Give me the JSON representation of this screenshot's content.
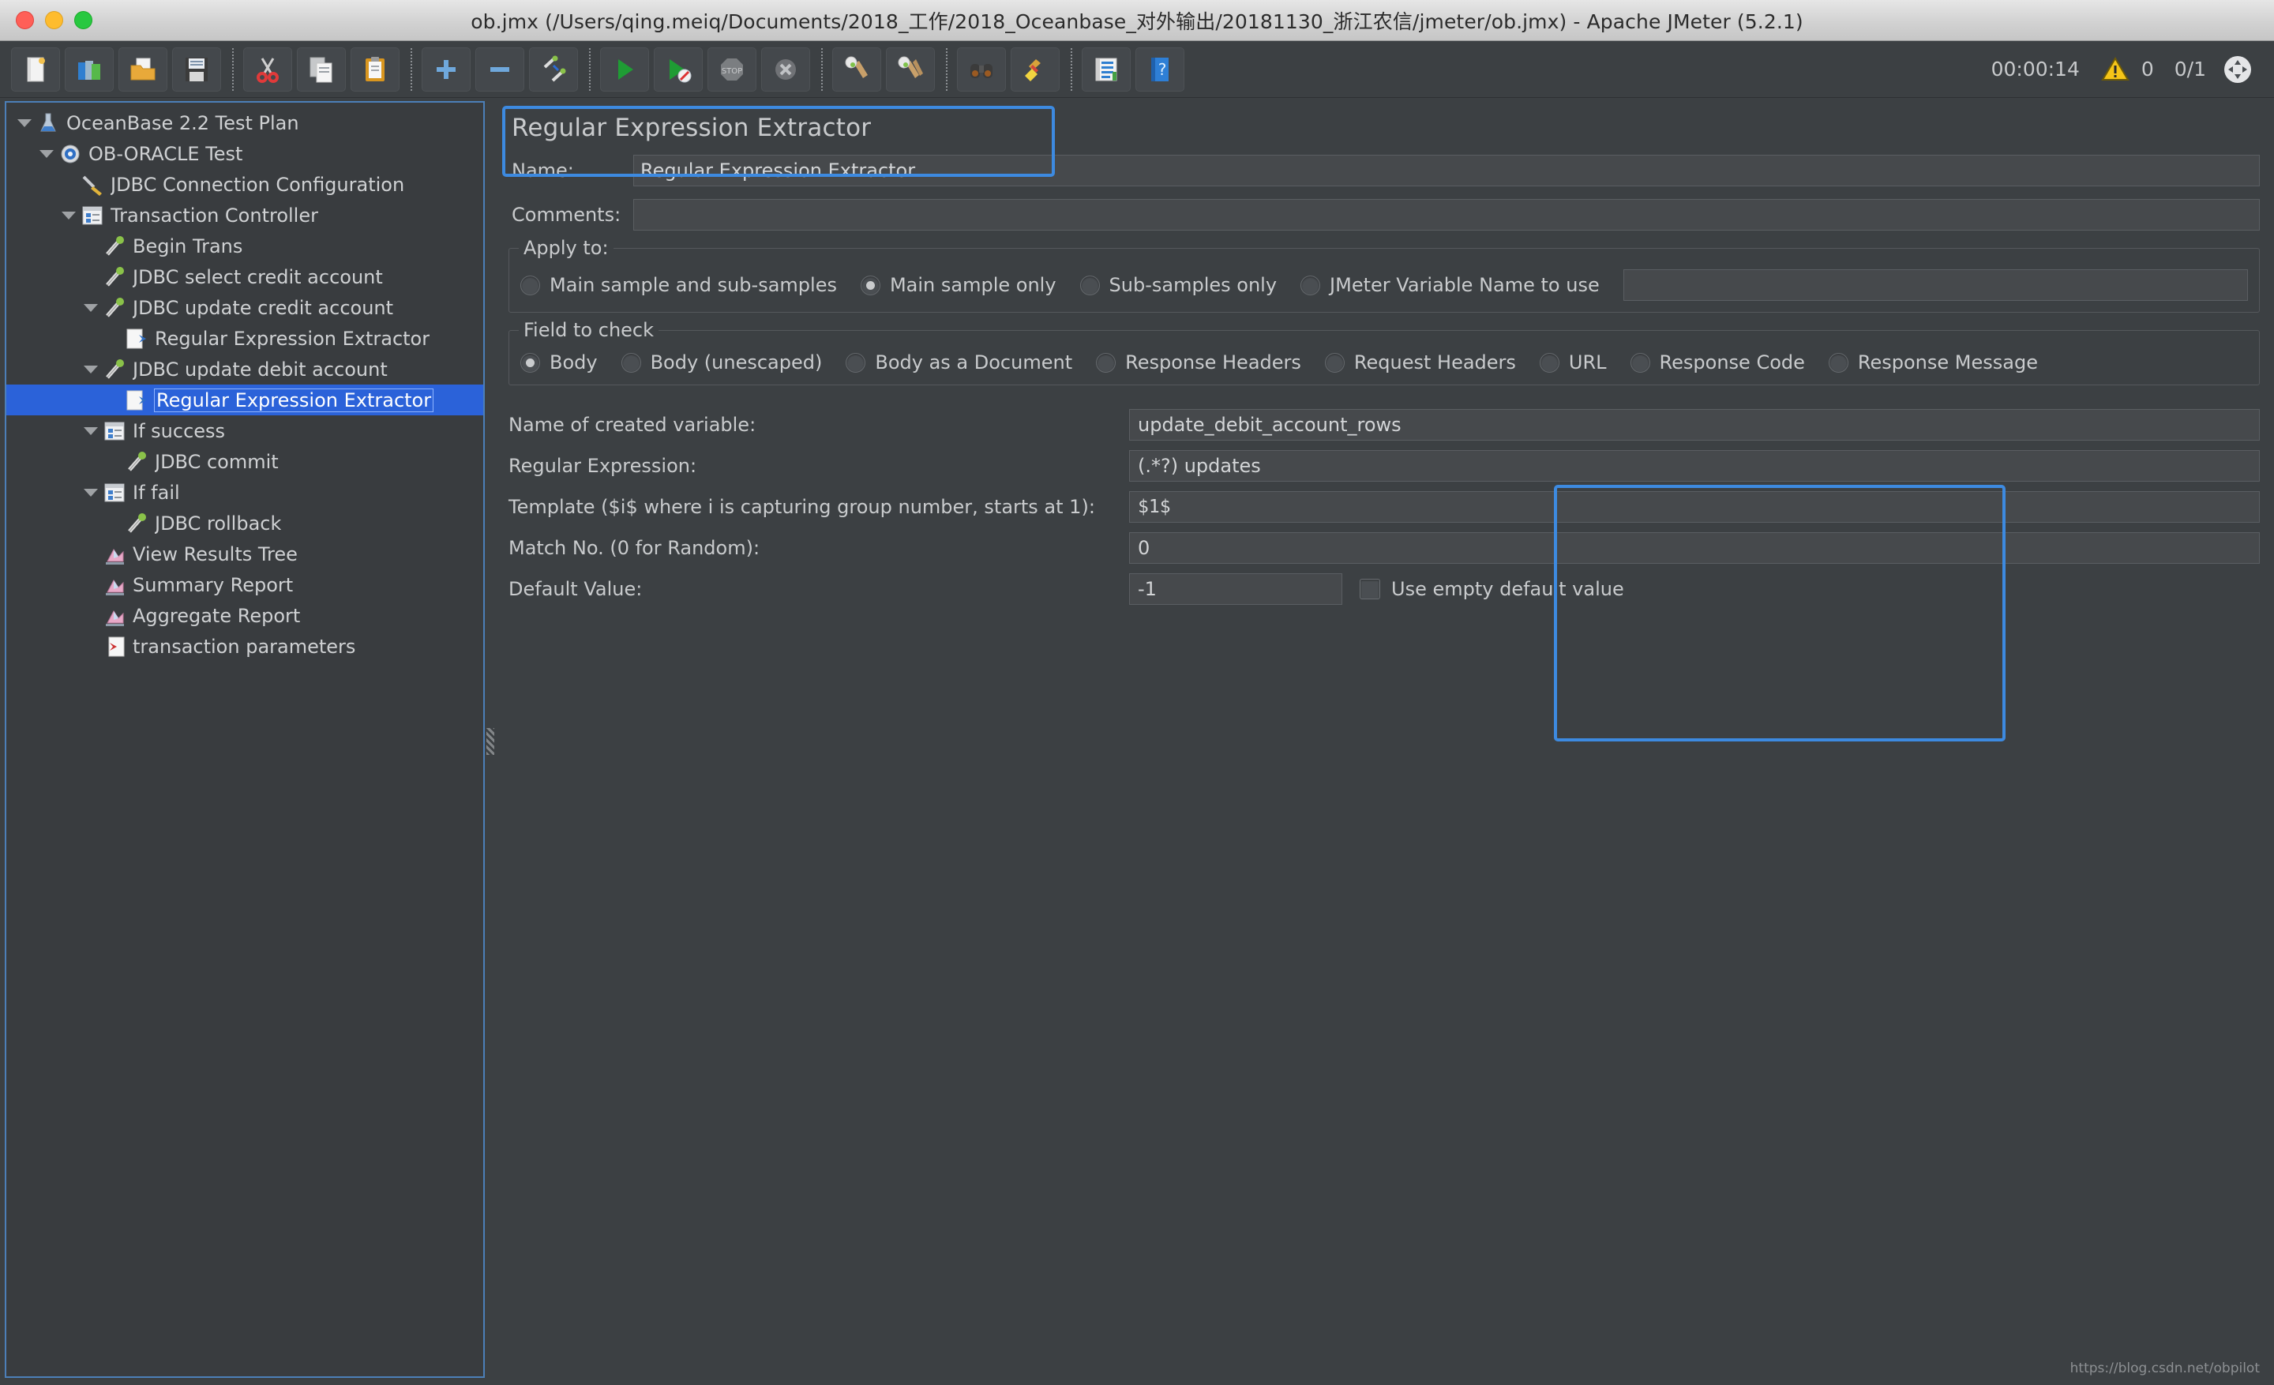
{
  "window": {
    "title": "ob.jmx (/Users/qing.meiq/Documents/2018_工作/2018_Oceanbase_对外输出/20181130_浙江农信/jmeter/ob.jmx) - Apache JMeter (5.2.1)",
    "close_label": "close",
    "minimize_label": "minimize",
    "maximize_label": "maximize"
  },
  "toolbar": {
    "buttons": [
      {
        "name": "new-test-plan",
        "icon": "new-document-icon"
      },
      {
        "name": "templates",
        "icon": "templates-icon"
      },
      {
        "name": "open",
        "icon": "open-folder-icon"
      },
      {
        "name": "save-test-plan",
        "icon": "save-floppy-icon"
      },
      {
        "name": "cut",
        "icon": "scissors-icon"
      },
      {
        "name": "copy",
        "icon": "copy-pages-icon"
      },
      {
        "name": "paste",
        "icon": "clipboard-icon"
      },
      {
        "name": "expand-all",
        "icon": "plus-icon"
      },
      {
        "name": "collapse-all",
        "icon": "minus-icon"
      },
      {
        "name": "toggle",
        "icon": "toggle-sampler-icon"
      },
      {
        "name": "start",
        "icon": "start-green-play-icon"
      },
      {
        "name": "start-no-timers",
        "icon": "start-no-pauses-icon"
      },
      {
        "name": "stop",
        "icon": "stop-sign-icon"
      },
      {
        "name": "shutdown",
        "icon": "shutdown-x-icon"
      },
      {
        "name": "clear",
        "icon": "clear-broom-icon"
      },
      {
        "name": "clear-all",
        "icon": "clear-all-brooms-icon"
      },
      {
        "name": "search",
        "icon": "binoculars-search-icon"
      },
      {
        "name": "reset-search",
        "icon": "yellow-broom-icon"
      },
      {
        "name": "function-helper",
        "icon": "function-helper-icon"
      },
      {
        "name": "help",
        "icon": "help-book-icon"
      }
    ],
    "timer": "00:00:14",
    "warning_count": "0",
    "thread_count": "0/1",
    "warn_icon": "warning-triangle-icon",
    "remote_icon": "thread-status-icon"
  },
  "tree": {
    "items": [
      {
        "label": "OceanBase 2.2 Test Plan",
        "indent": 0,
        "twisty": "open",
        "icon": "test-plan-flask-icon",
        "selected": false
      },
      {
        "label": "OB-ORACLE Test",
        "indent": 1,
        "twisty": "open",
        "icon": "thread-group-gear-icon",
        "selected": false
      },
      {
        "label": "JDBC Connection Configuration",
        "indent": 2,
        "twisty": "none",
        "icon": "config-wrench-icon",
        "selected": false
      },
      {
        "label": "Transaction Controller",
        "indent": 2,
        "twisty": "open",
        "icon": "controller-icon",
        "selected": false
      },
      {
        "label": "Begin Trans",
        "indent": 3,
        "twisty": "none",
        "icon": "sampler-pipette-icon",
        "selected": false
      },
      {
        "label": "JDBC select credit account",
        "indent": 3,
        "twisty": "none",
        "icon": "sampler-pipette-icon",
        "selected": false
      },
      {
        "label": "JDBC update credit account",
        "indent": 3,
        "twisty": "open",
        "icon": "sampler-pipette-icon",
        "selected": false
      },
      {
        "label": "Regular Expression Extractor",
        "indent": 4,
        "twisty": "none",
        "icon": "post-processor-icon",
        "selected": false
      },
      {
        "label": "JDBC update debit account",
        "indent": 3,
        "twisty": "open",
        "icon": "sampler-pipette-icon",
        "selected": false
      },
      {
        "label": "Regular Expression Extractor",
        "indent": 4,
        "twisty": "none",
        "icon": "post-processor-icon",
        "selected": true
      },
      {
        "label": "If success",
        "indent": 3,
        "twisty": "open",
        "icon": "controller-icon",
        "selected": false
      },
      {
        "label": "JDBC commit",
        "indent": 4,
        "twisty": "none",
        "icon": "sampler-pipette-icon",
        "selected": false
      },
      {
        "label": "If fail",
        "indent": 3,
        "twisty": "open",
        "icon": "controller-icon",
        "selected": false
      },
      {
        "label": "JDBC rollback",
        "indent": 4,
        "twisty": "none",
        "icon": "sampler-pipette-icon",
        "selected": false
      },
      {
        "label": "View Results Tree",
        "indent": 3,
        "twisty": "none",
        "icon": "listener-chart-icon",
        "selected": false
      },
      {
        "label": "Summary Report",
        "indent": 3,
        "twisty": "none",
        "icon": "listener-chart-icon",
        "selected": false
      },
      {
        "label": "Aggregate Report",
        "indent": 3,
        "twisty": "none",
        "icon": "listener-chart-icon",
        "selected": false
      },
      {
        "label": "transaction parameters",
        "indent": 3,
        "twisty": "none",
        "icon": "csv-dataset-icon",
        "selected": false
      }
    ]
  },
  "editor": {
    "panel_title": "Regular Expression Extractor",
    "name_label": "Name:",
    "name_value": "Regular Expression Extractor",
    "comments_label": "Comments:",
    "comments_value": "",
    "apply_to": {
      "legend": "Apply to:",
      "options": [
        {
          "label": "Main sample and sub-samples",
          "checked": false
        },
        {
          "label": "Main sample only",
          "checked": true
        },
        {
          "label": "Sub-samples only",
          "checked": false
        },
        {
          "label": "JMeter Variable Name to use",
          "checked": false
        }
      ],
      "variable_value": ""
    },
    "field_to_check": {
      "legend": "Field to check",
      "options": [
        {
          "label": "Body",
          "checked": true
        },
        {
          "label": "Body (unescaped)",
          "checked": false
        },
        {
          "label": "Body as a Document",
          "checked": false
        },
        {
          "label": "Response Headers",
          "checked": false
        },
        {
          "label": "Request Headers",
          "checked": false
        },
        {
          "label": "URL",
          "checked": false
        },
        {
          "label": "Response Code",
          "checked": false
        },
        {
          "label": "Response Message",
          "checked": false
        }
      ]
    },
    "fields": {
      "variable_name_label": "Name of created variable:",
      "variable_name_value": "update_debit_account_rows",
      "regex_label": "Regular Expression:",
      "regex_value": "(.*?) updates",
      "template_label": "Template ($i$ where i is capturing group number, starts at 1):",
      "template_value": "$1$",
      "match_no_label": "Match No. (0 for Random):",
      "match_no_value": "0",
      "default_value_label": "Default Value:",
      "default_value_value": "-1",
      "use_empty_default_label": "Use empty default value",
      "use_empty_default_checked": false
    }
  },
  "watermark": "https://blog.csdn.net/obpilot",
  "colors": {
    "accent_highlight": "#3d8ae0",
    "selection": "#2b62d9",
    "panel_bg": "#3c4043",
    "field_bg": "#46494c",
    "warning": "#f5c518"
  }
}
